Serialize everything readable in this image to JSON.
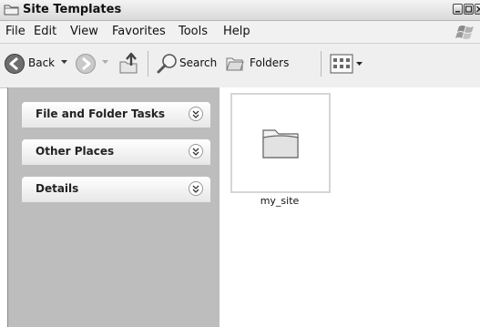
{
  "window": {
    "title": "Site Templates"
  },
  "menu": {
    "items": [
      "File",
      "Edit",
      "View",
      "Favorites",
      "Tools",
      "Help"
    ]
  },
  "toolbar": {
    "back": "Back",
    "search": "Search",
    "folders": "Folders"
  },
  "taskpane": {
    "groups": [
      {
        "title": "File and Folder Tasks"
      },
      {
        "title": "Other Places"
      },
      {
        "title": "Details"
      }
    ]
  },
  "content": {
    "items": [
      {
        "name": "my_site",
        "icon": "folder-icon"
      }
    ]
  }
}
